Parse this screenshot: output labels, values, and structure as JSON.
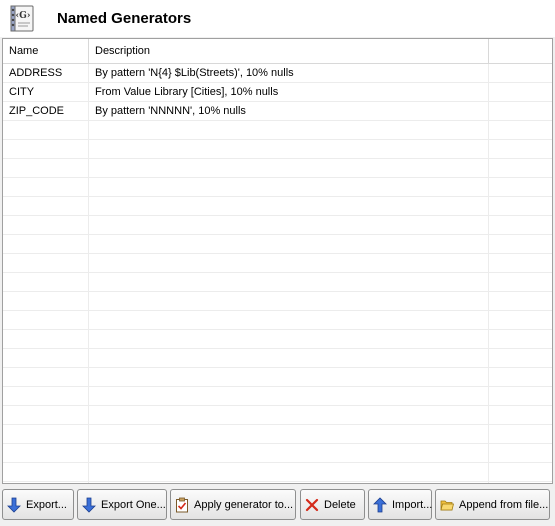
{
  "header": {
    "title": "Named Generators",
    "icon": "generator-book-icon"
  },
  "table": {
    "columns": [
      "Name",
      "Description"
    ],
    "rows": [
      {
        "name": "ADDRESS",
        "description": "By pattern 'N{4} $Lib(Streets)', 10% nulls"
      },
      {
        "name": "CITY",
        "description": "From Value Library [Cities], 10% nulls"
      },
      {
        "name": "ZIP_CODE",
        "description": "By pattern 'NNNNN', 10% nulls"
      }
    ]
  },
  "toolbar": {
    "export_label": "Export...",
    "export_one_label": "Export One...",
    "apply_label": "Apply generator to...",
    "delete_label": "Delete",
    "import_label": "Import...",
    "append_label": "Append from file..."
  },
  "colors": {
    "arrow_blue": "#3a6fd8",
    "delete_red": "#d42a1a",
    "folder_yellow": "#f0c040"
  }
}
